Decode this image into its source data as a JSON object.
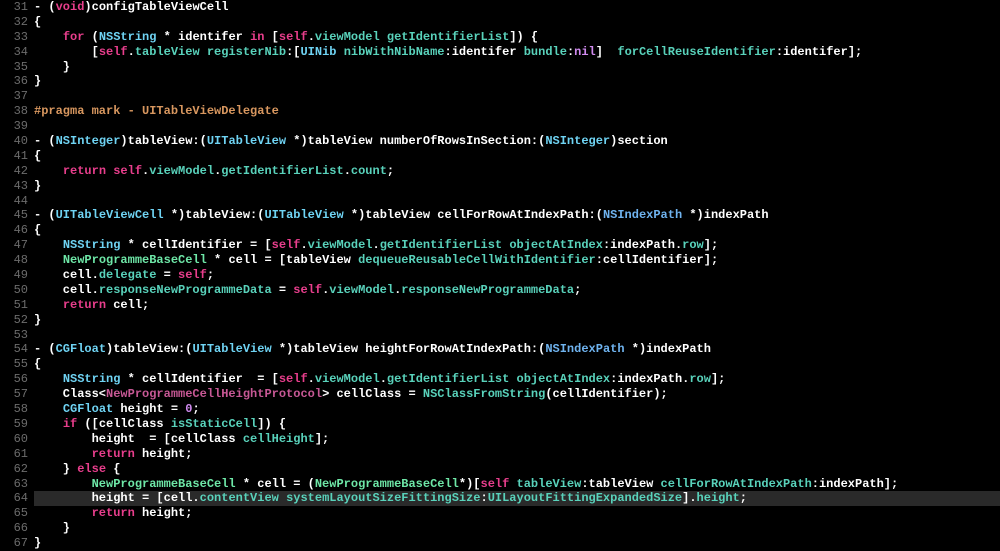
{
  "first_line_number": 31,
  "highlighted_line_index": 33,
  "lines": [
    [
      [
        "plain",
        "- ("
      ],
      [
        "keyword",
        "void"
      ],
      [
        "plain",
        ")configTableViewCell"
      ]
    ],
    [
      [
        "plain",
        "{"
      ]
    ],
    [
      [
        "plain",
        "    "
      ],
      [
        "keyword",
        "for"
      ],
      [
        "plain",
        " ("
      ],
      [
        "type",
        "NSString"
      ],
      [
        "plain",
        " * identifer "
      ],
      [
        "keyword",
        "in"
      ],
      [
        "plain",
        " ["
      ],
      [
        "keyword",
        "self"
      ],
      [
        "plain",
        "."
      ],
      [
        "prop",
        "viewModel"
      ],
      [
        "plain",
        " "
      ],
      [
        "prop",
        "getIdentifierList"
      ],
      [
        "plain",
        "]) {"
      ]
    ],
    [
      [
        "plain",
        "        ["
      ],
      [
        "keyword",
        "self"
      ],
      [
        "plain",
        "."
      ],
      [
        "prop",
        "tableView"
      ],
      [
        "plain",
        " "
      ],
      [
        "prop",
        "registerNib"
      ],
      [
        "plain",
        ":["
      ],
      [
        "type",
        "UINib"
      ],
      [
        "plain",
        " "
      ],
      [
        "prop",
        "nibWithNibName"
      ],
      [
        "plain",
        ":identifer "
      ],
      [
        "prop",
        "bundle"
      ],
      [
        "plain",
        ":"
      ],
      [
        "nil",
        "nil"
      ],
      [
        "plain",
        "]  "
      ],
      [
        "prop",
        "forCellReuseIdentifier"
      ],
      [
        "plain",
        ":identifer];"
      ]
    ],
    [
      [
        "plain",
        "    }"
      ]
    ],
    [
      [
        "plain",
        "}"
      ]
    ],
    [
      [
        "plain",
        ""
      ]
    ],
    [
      [
        "pragma",
        "#pragma mark - UITableViewDelegate"
      ]
    ],
    [
      [
        "plain",
        ""
      ]
    ],
    [
      [
        "plain",
        "- ("
      ],
      [
        "type",
        "NSInteger"
      ],
      [
        "plain",
        ")tableView:("
      ],
      [
        "type",
        "UITableView"
      ],
      [
        "plain",
        " *)tableView numberOfRowsInSection:("
      ],
      [
        "type",
        "NSInteger"
      ],
      [
        "plain",
        ")section"
      ]
    ],
    [
      [
        "plain",
        "{"
      ]
    ],
    [
      [
        "plain",
        "    "
      ],
      [
        "keyword",
        "return"
      ],
      [
        "plain",
        " "
      ],
      [
        "keyword",
        "self"
      ],
      [
        "plain",
        "."
      ],
      [
        "prop",
        "viewModel"
      ],
      [
        "plain",
        "."
      ],
      [
        "prop",
        "getIdentifierList"
      ],
      [
        "plain",
        "."
      ],
      [
        "prop",
        "count"
      ],
      [
        "plain",
        ";"
      ]
    ],
    [
      [
        "plain",
        "}"
      ]
    ],
    [
      [
        "plain",
        ""
      ]
    ],
    [
      [
        "plain",
        "- ("
      ],
      [
        "type",
        "UITableViewCell"
      ],
      [
        "plain",
        " *)tableView:("
      ],
      [
        "type",
        "UITableView"
      ],
      [
        "plain",
        " *)tableView cellForRowAtIndexPath:("
      ],
      [
        "type2",
        "NSIndexPath"
      ],
      [
        "plain",
        " *)indexPath"
      ]
    ],
    [
      [
        "plain",
        "{"
      ]
    ],
    [
      [
        "plain",
        "    "
      ],
      [
        "type",
        "NSString"
      ],
      [
        "plain",
        " * cellIdentifier = ["
      ],
      [
        "keyword",
        "self"
      ],
      [
        "plain",
        "."
      ],
      [
        "prop",
        "viewModel"
      ],
      [
        "plain",
        "."
      ],
      [
        "prop",
        "getIdentifierList"
      ],
      [
        "plain",
        " "
      ],
      [
        "prop",
        "objectAtIndex"
      ],
      [
        "plain",
        ":indexPath."
      ],
      [
        "prop",
        "row"
      ],
      [
        "plain",
        "];"
      ]
    ],
    [
      [
        "plain",
        "    "
      ],
      [
        "ident",
        "NewProgrammeBaseCell"
      ],
      [
        "plain",
        " * cell = [tableView "
      ],
      [
        "prop",
        "dequeueReusableCellWithIdentifier"
      ],
      [
        "plain",
        ":cellIdentifier];"
      ]
    ],
    [
      [
        "plain",
        "    cell."
      ],
      [
        "prop",
        "delegate"
      ],
      [
        "plain",
        " = "
      ],
      [
        "keyword",
        "self"
      ],
      [
        "plain",
        ";"
      ]
    ],
    [
      [
        "plain",
        "    cell."
      ],
      [
        "prop",
        "responseNewProgrammeData"
      ],
      [
        "plain",
        " = "
      ],
      [
        "keyword",
        "self"
      ],
      [
        "plain",
        "."
      ],
      [
        "prop",
        "viewModel"
      ],
      [
        "plain",
        "."
      ],
      [
        "prop",
        "responseNewProgrammeData"
      ],
      [
        "plain",
        ";"
      ]
    ],
    [
      [
        "plain",
        "    "
      ],
      [
        "keyword",
        "return"
      ],
      [
        "plain",
        " cell;"
      ]
    ],
    [
      [
        "plain",
        "}"
      ]
    ],
    [
      [
        "plain",
        ""
      ]
    ],
    [
      [
        "plain",
        "- ("
      ],
      [
        "type",
        "CGFloat"
      ],
      [
        "plain",
        ")tableView:("
      ],
      [
        "type",
        "UITableView"
      ],
      [
        "plain",
        " *)tableView heightForRowAtIndexPath:("
      ],
      [
        "type2",
        "NSIndexPath"
      ],
      [
        "plain",
        " *)indexPath"
      ]
    ],
    [
      [
        "plain",
        "{"
      ]
    ],
    [
      [
        "plain",
        "    "
      ],
      [
        "type",
        "NSString"
      ],
      [
        "plain",
        " * cellIdentifier  = ["
      ],
      [
        "keyword",
        "self"
      ],
      [
        "plain",
        "."
      ],
      [
        "prop",
        "viewModel"
      ],
      [
        "plain",
        "."
      ],
      [
        "prop",
        "getIdentifierList"
      ],
      [
        "plain",
        " "
      ],
      [
        "prop",
        "objectAtIndex"
      ],
      [
        "plain",
        ":indexPath."
      ],
      [
        "prop",
        "row"
      ],
      [
        "plain",
        "];"
      ]
    ],
    [
      [
        "plain",
        "    Class<"
      ],
      [
        "pink2",
        "NewProgrammeCellHeightProtocol"
      ],
      [
        "plain",
        "> cellClass = "
      ],
      [
        "prop",
        "NSClassFromString"
      ],
      [
        "plain",
        "(cellIdentifier);"
      ]
    ],
    [
      [
        "plain",
        "    "
      ],
      [
        "type",
        "CGFloat"
      ],
      [
        "plain",
        " height = "
      ],
      [
        "num",
        "0"
      ],
      [
        "plain",
        ";"
      ]
    ],
    [
      [
        "plain",
        "    "
      ],
      [
        "keyword",
        "if"
      ],
      [
        "plain",
        " ([cellClass "
      ],
      [
        "prop",
        "isStaticCell"
      ],
      [
        "plain",
        "]) {"
      ]
    ],
    [
      [
        "plain",
        "        height  = [cellClass "
      ],
      [
        "prop",
        "cellHeight"
      ],
      [
        "plain",
        "];"
      ]
    ],
    [
      [
        "plain",
        "        "
      ],
      [
        "keyword",
        "return"
      ],
      [
        "plain",
        " height;"
      ]
    ],
    [
      [
        "plain",
        "    } "
      ],
      [
        "keyword",
        "else"
      ],
      [
        "plain",
        " {"
      ]
    ],
    [
      [
        "plain",
        "        "
      ],
      [
        "ident",
        "NewProgrammeBaseCell"
      ],
      [
        "plain",
        " * cell = ("
      ],
      [
        "ident",
        "NewProgrammeBaseCell"
      ],
      [
        "plain",
        "*)["
      ],
      [
        "keyword",
        "self"
      ],
      [
        "plain",
        " "
      ],
      [
        "prop",
        "tableView"
      ],
      [
        "plain",
        ":tableView "
      ],
      [
        "prop",
        "cellForRowAtIndexPath"
      ],
      [
        "plain",
        ":indexPath];"
      ]
    ],
    [
      [
        "plain",
        "        height = [cell."
      ],
      [
        "prop",
        "contentView"
      ],
      [
        "plain",
        " "
      ],
      [
        "prop",
        "systemLayoutSizeFittingSize"
      ],
      [
        "plain",
        ":"
      ],
      [
        "prop",
        "UILayoutFittingExpandedSize"
      ],
      [
        "plain",
        "]."
      ],
      [
        "prop",
        "height"
      ],
      [
        "plain",
        ";"
      ]
    ],
    [
      [
        "plain",
        "        "
      ],
      [
        "keyword",
        "return"
      ],
      [
        "plain",
        " height;"
      ]
    ],
    [
      [
        "plain",
        "    }"
      ]
    ],
    [
      [
        "plain",
        "}"
      ]
    ]
  ]
}
